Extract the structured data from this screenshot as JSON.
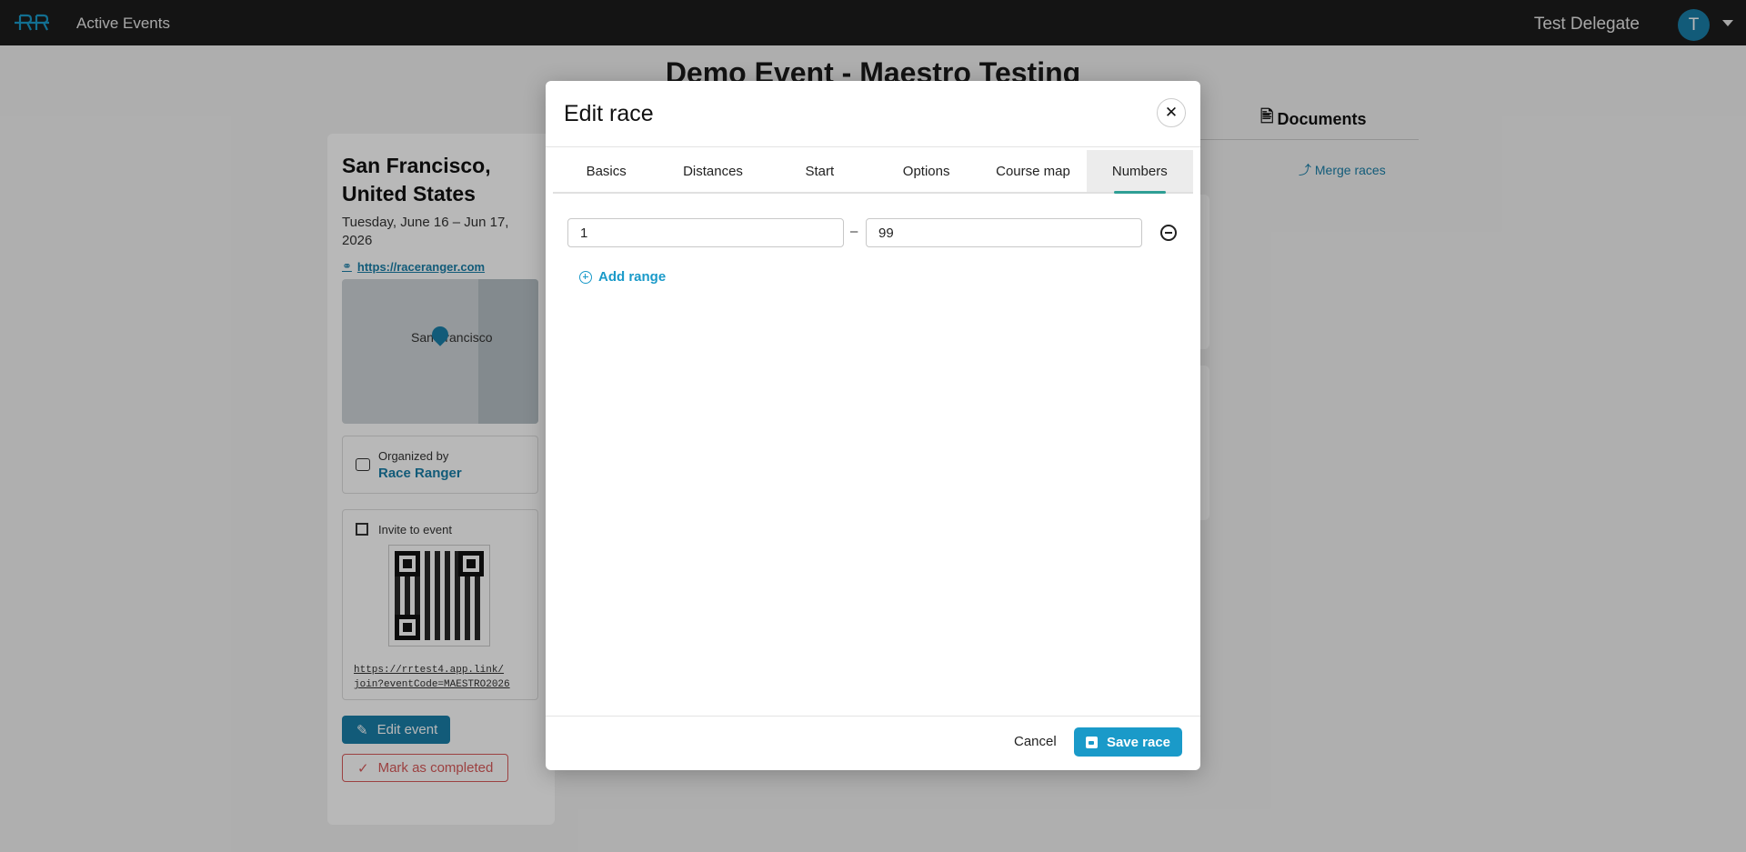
{
  "topbar": {
    "nav_link": "Active Events",
    "user_name": "Test Delegate",
    "avatar_initial": "T"
  },
  "background": {
    "page_title": "Demo Event - Maestro Testing",
    "city": "San Francisco, United States",
    "dates": "Tuesday, June 16 – Jun 17, 2026",
    "website": "https://raceranger.com",
    "map_label": "San Francisco",
    "organized_by_label": "Organized by",
    "organizer": "Race Ranger",
    "invite_label": "Invite to event",
    "invite_link_line1": "https://rrtest4.app.link/",
    "invite_link_line2": "join?eventCode=MAESTRO2026",
    "edit_event": "Edit event",
    "mark_completed": "Mark as completed",
    "documents_tab": "Documents",
    "merge_races": "Merge races"
  },
  "modal": {
    "title": "Edit race",
    "tabs": [
      {
        "label": "Basics"
      },
      {
        "label": "Distances"
      },
      {
        "label": "Start"
      },
      {
        "label": "Options"
      },
      {
        "label": "Course map"
      },
      {
        "label": "Numbers"
      }
    ],
    "active_tab": "Numbers",
    "ranges": [
      {
        "from": "1",
        "separator": "–",
        "to": "99"
      }
    ],
    "add_range": "Add range",
    "cancel": "Cancel",
    "save": "Save race"
  },
  "colors": {
    "accent": "#1a9ac9",
    "brand": "#1a7fa8",
    "tab_indicator": "#2e9e94",
    "danger": "#d85a5a"
  }
}
